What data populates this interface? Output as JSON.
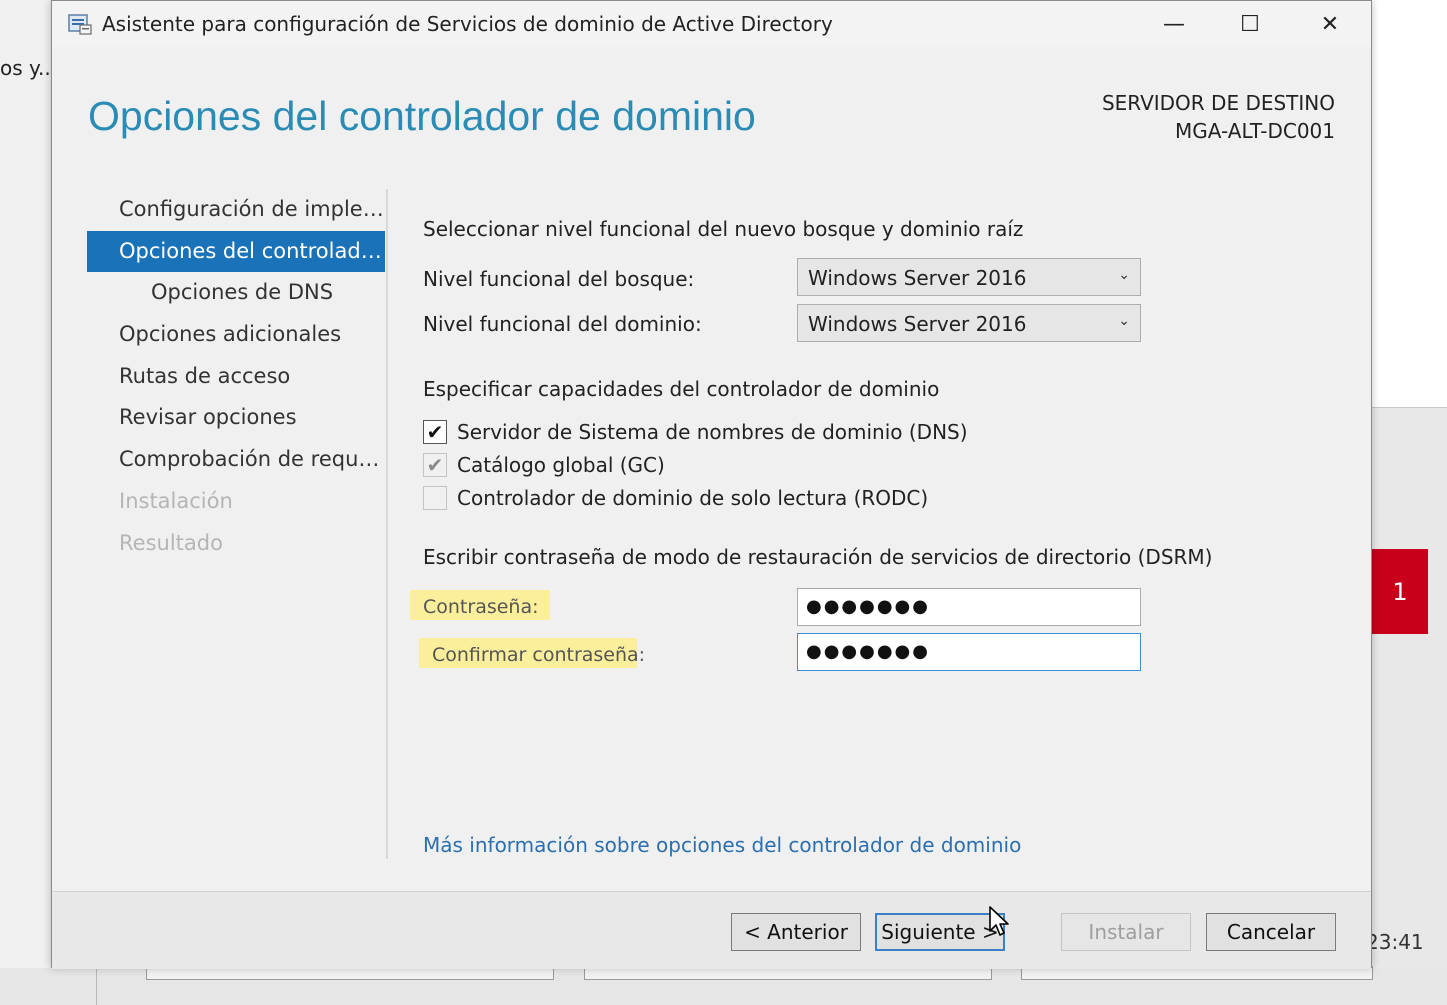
{
  "background": {
    "left_text": "os y...",
    "right_tile_number": "1",
    "clock_fragment": "23:41"
  },
  "window": {
    "title": "Asistente para configuración de Servicios de dominio de Active Directory",
    "controls": {
      "minimize": "—",
      "maximize": "☐",
      "close": "✕"
    }
  },
  "header": {
    "page_title": "Opciones del controlador de dominio",
    "target_label": "SERVIDOR DE DESTINO",
    "target_server": "MGA-ALT-DC001"
  },
  "nav": {
    "items": [
      {
        "label": "Configuración de implem...",
        "state": "normal"
      },
      {
        "label": "Opciones del controlador...",
        "state": "active"
      },
      {
        "label": "Opciones de DNS",
        "state": "sub"
      },
      {
        "label": "Opciones adicionales",
        "state": "normal"
      },
      {
        "label": "Rutas de acceso",
        "state": "normal"
      },
      {
        "label": "Revisar opciones",
        "state": "normal"
      },
      {
        "label": "Comprobación de requisi...",
        "state": "normal"
      },
      {
        "label": "Instalación",
        "state": "disabled"
      },
      {
        "label": "Resultado",
        "state": "disabled"
      }
    ]
  },
  "main": {
    "functional_level_heading": "Seleccionar nivel funcional del nuevo bosque y dominio raíz",
    "forest_level_label": "Nivel funcional del bosque:",
    "forest_level_value": "Windows Server 2016",
    "domain_level_label": "Nivel funcional del dominio:",
    "domain_level_value": "Windows Server 2016",
    "capabilities_heading": "Especificar capacidades del controlador de dominio",
    "capabilities": [
      {
        "label": "Servidor de Sistema de nombres de dominio (DNS)",
        "checked": true,
        "enabled": true
      },
      {
        "label": "Catálogo global (GC)",
        "checked": true,
        "enabled": false
      },
      {
        "label": "Controlador de dominio de solo lectura (RODC)",
        "checked": false,
        "enabled": false
      }
    ],
    "dsrm_heading": "Escribir contraseña de modo de restauración de servicios de directorio (DSRM)",
    "password_label": "Contraseña:",
    "password_value": "●●●●●●●",
    "confirm_label": "Confirmar contraseña:",
    "confirm_value": "●●●●●●●",
    "more_info_link": "Más información sobre opciones del controlador de dominio"
  },
  "footer": {
    "back_label": "< Anterior",
    "next_label": "Siguiente >",
    "install_label": "Instalar",
    "cancel_label": "Cancelar"
  },
  "colors": {
    "accent": "#1a73b8",
    "title": "#2a8cb5",
    "link": "#2a6fb0",
    "highlight": "#fbef9c",
    "tile_red": "#c8001a"
  },
  "icons": {
    "app": "ad-wizard-icon",
    "check": "check-icon",
    "chevron": "chevron-down-icon",
    "cursor": "mouse-cursor-icon"
  }
}
